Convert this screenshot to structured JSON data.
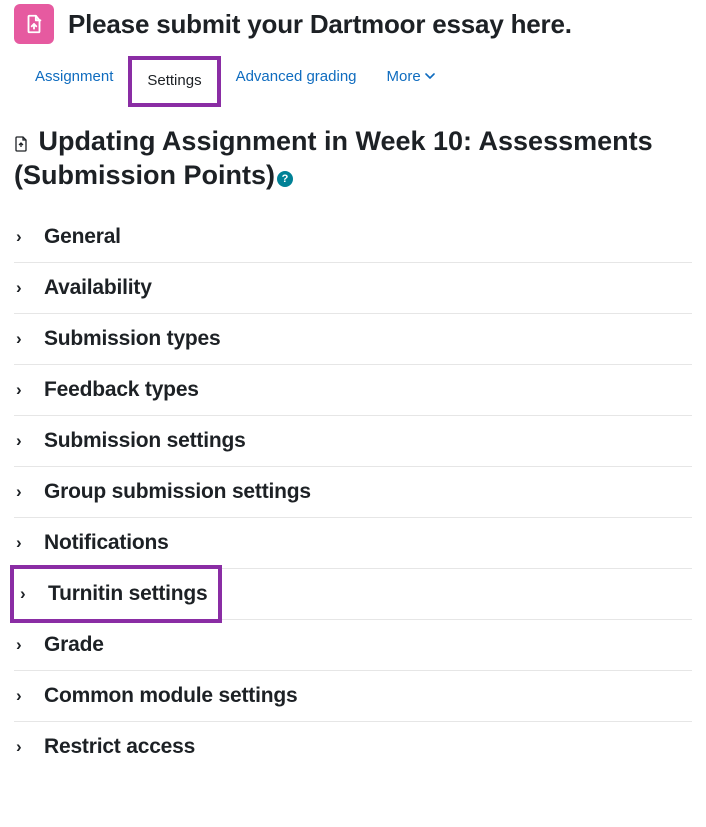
{
  "header": {
    "title": "Please submit your Dartmoor essay here."
  },
  "tabs": {
    "items": [
      {
        "label": "Assignment"
      },
      {
        "label": "Settings"
      },
      {
        "label": "Advanced grading"
      },
      {
        "label": "More"
      }
    ]
  },
  "heading": {
    "text": "Updating Assignment in Week 10: Assessments (Submission Points)"
  },
  "sections": [
    {
      "label": "General"
    },
    {
      "label": "Availability"
    },
    {
      "label": "Submission types"
    },
    {
      "label": "Feedback types"
    },
    {
      "label": "Submission settings"
    },
    {
      "label": "Group submission settings"
    },
    {
      "label": "Notifications"
    },
    {
      "label": "Turnitin settings"
    },
    {
      "label": "Grade"
    },
    {
      "label": "Common module settings"
    },
    {
      "label": "Restrict access"
    }
  ],
  "colors": {
    "link": "#0f6cbf",
    "highlight": "#8a2da4",
    "activity_bg": "#e65aa0",
    "help_bg": "#008196"
  }
}
